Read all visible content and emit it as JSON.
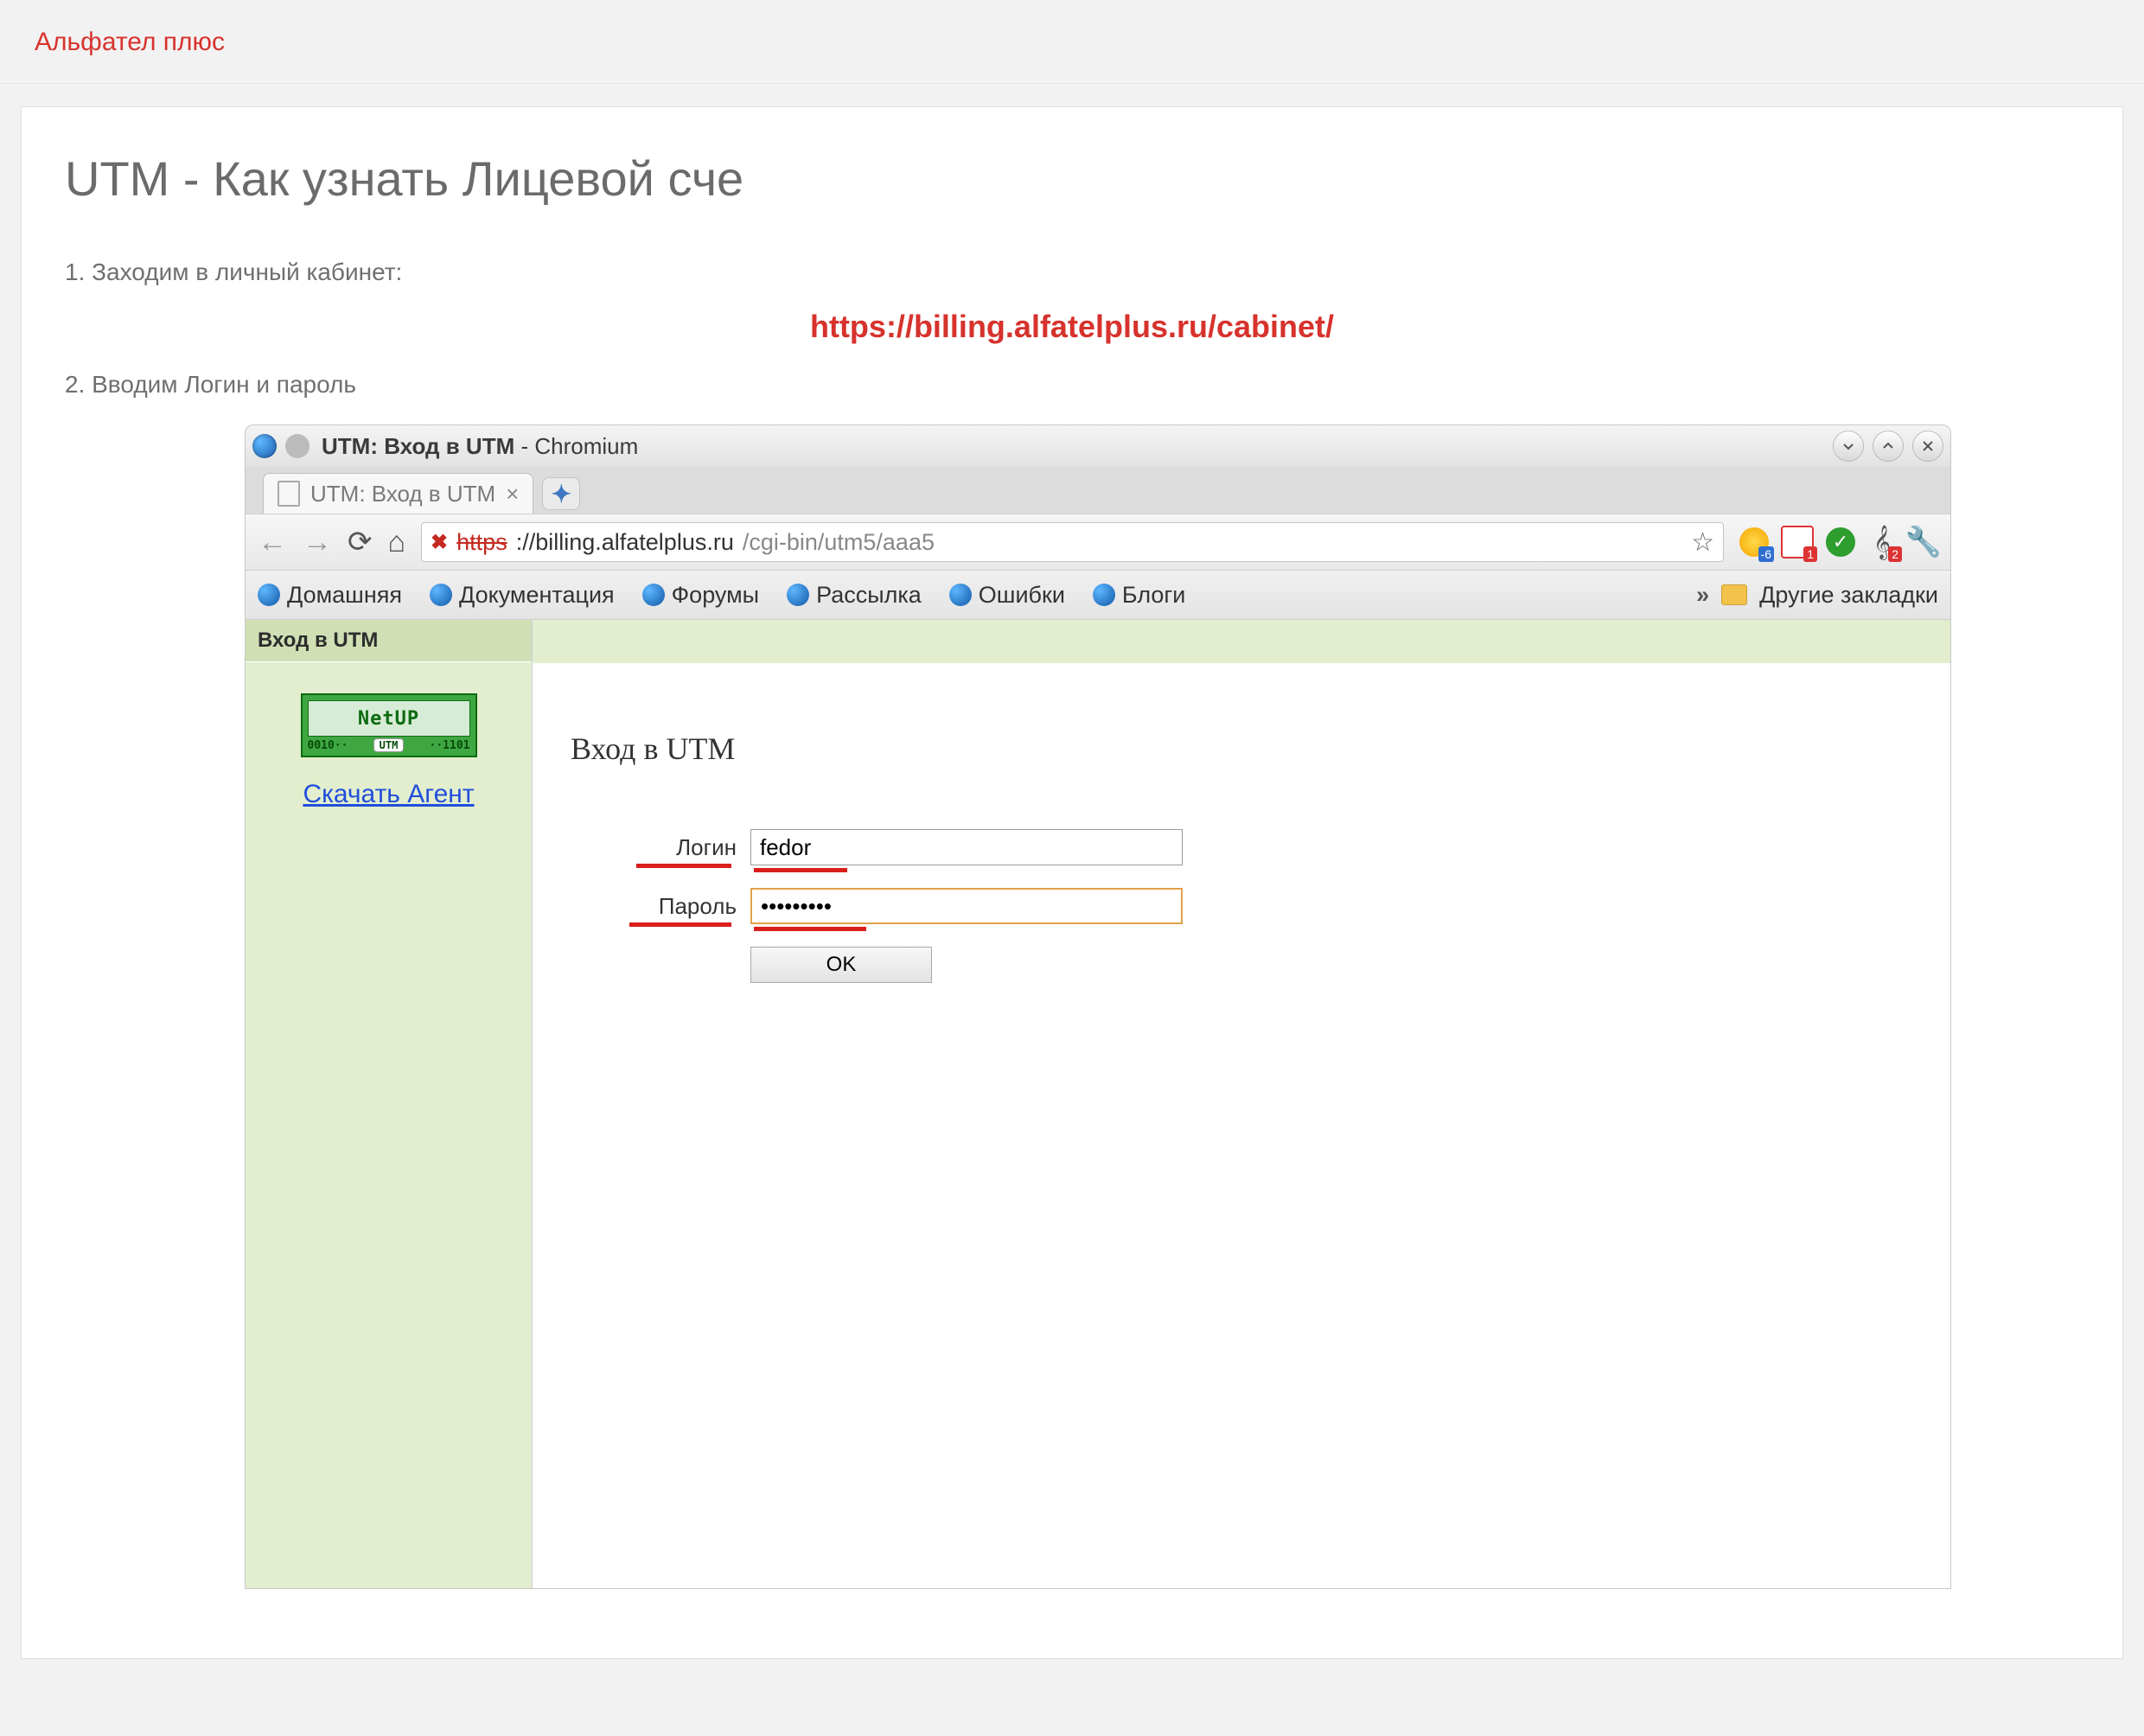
{
  "brand": {
    "name": "Альфател плюс"
  },
  "article": {
    "title": "UTM - Как узнать Лицевой сче",
    "step1": "1. Заходим в личный кабинет:",
    "cabinet_url": "https://billing.alfatelplus.ru/cabinet/",
    "step2": "2. Вводим Логин и пароль"
  },
  "browser": {
    "window_title_main": "UTM: Вход в UTM",
    "window_title_suffix": " - Chromium",
    "tab_label": "UTM: Вход в UTM",
    "url_https": "https",
    "url_host": "://billing.alfatelplus.ru",
    "url_path": "/cgi-bin/utm5/aaa5",
    "bookmarks": [
      "Домашняя",
      "Документация",
      "Форумы",
      "Рассылка",
      "Ошибки",
      "Блоги"
    ],
    "other_bookmarks": "Другие закладки"
  },
  "utm_page": {
    "sidebar_title": "Вход в UTM",
    "netup_label": "NetUP",
    "netup_left": "0010··",
    "netup_chip": "UTM",
    "netup_right": "··1101",
    "download_link": "Скачать Агент",
    "heading": "Вход в UTM",
    "login_label": "Логин",
    "login_value": "fedor",
    "password_label": "Пароль",
    "password_value": "•••••••••",
    "ok_label": "OK"
  }
}
